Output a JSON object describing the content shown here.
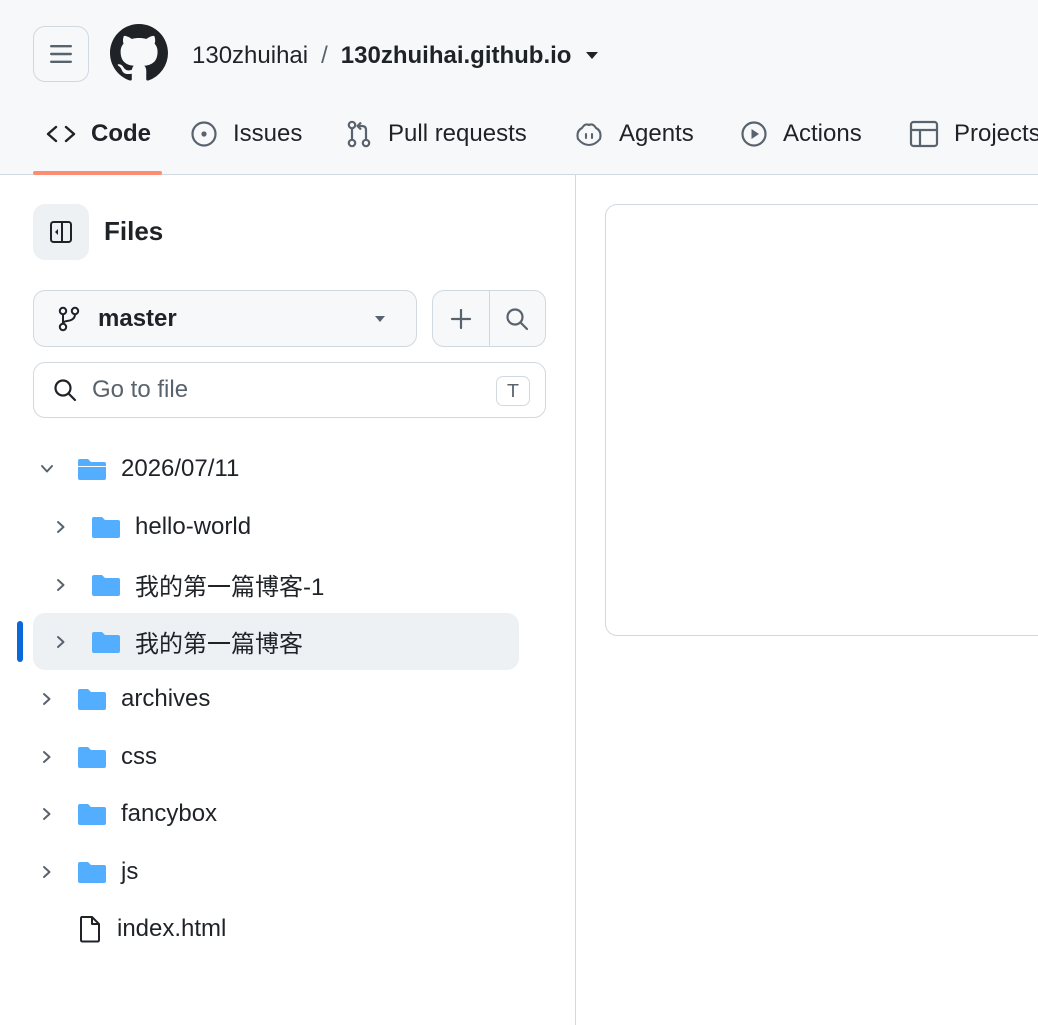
{
  "header": {
    "owner": "130zhuihai",
    "separator": "/",
    "repo": "130zhuihai.github.io"
  },
  "tabs": [
    {
      "label": "Code",
      "icon": "code-icon",
      "active": true
    },
    {
      "label": "Issues",
      "icon": "issue-opened-icon"
    },
    {
      "label": "Pull requests",
      "icon": "git-pull-request-icon"
    },
    {
      "label": "Agents",
      "icon": "copilot-icon"
    },
    {
      "label": "Actions",
      "icon": "play-icon"
    },
    {
      "label": "Projects",
      "icon": "table-icon"
    }
  ],
  "sidebar": {
    "title": "Files",
    "branch": "master",
    "goto_placeholder": "Go to file",
    "goto_shortcut": "T",
    "tree": [
      {
        "label": "2026/07/11",
        "type": "folder-open",
        "expanded": true,
        "depth": 0
      },
      {
        "label": "hello-world",
        "type": "folder",
        "depth": 1
      },
      {
        "label": "我的第一篇博客-1",
        "type": "folder",
        "depth": 1
      },
      {
        "label": "我的第一篇博客",
        "type": "folder",
        "depth": 1,
        "selected": true
      },
      {
        "label": "archives",
        "type": "folder",
        "depth": 0
      },
      {
        "label": "css",
        "type": "folder",
        "depth": 0
      },
      {
        "label": "fancybox",
        "type": "folder",
        "depth": 0
      },
      {
        "label": "js",
        "type": "folder",
        "depth": 0
      },
      {
        "label": "index.html",
        "type": "file",
        "depth": 0
      }
    ]
  },
  "colors": {
    "accent_underline": "#fd8c73",
    "folder": "#54aeff",
    "selected_bar": "#0969da"
  }
}
